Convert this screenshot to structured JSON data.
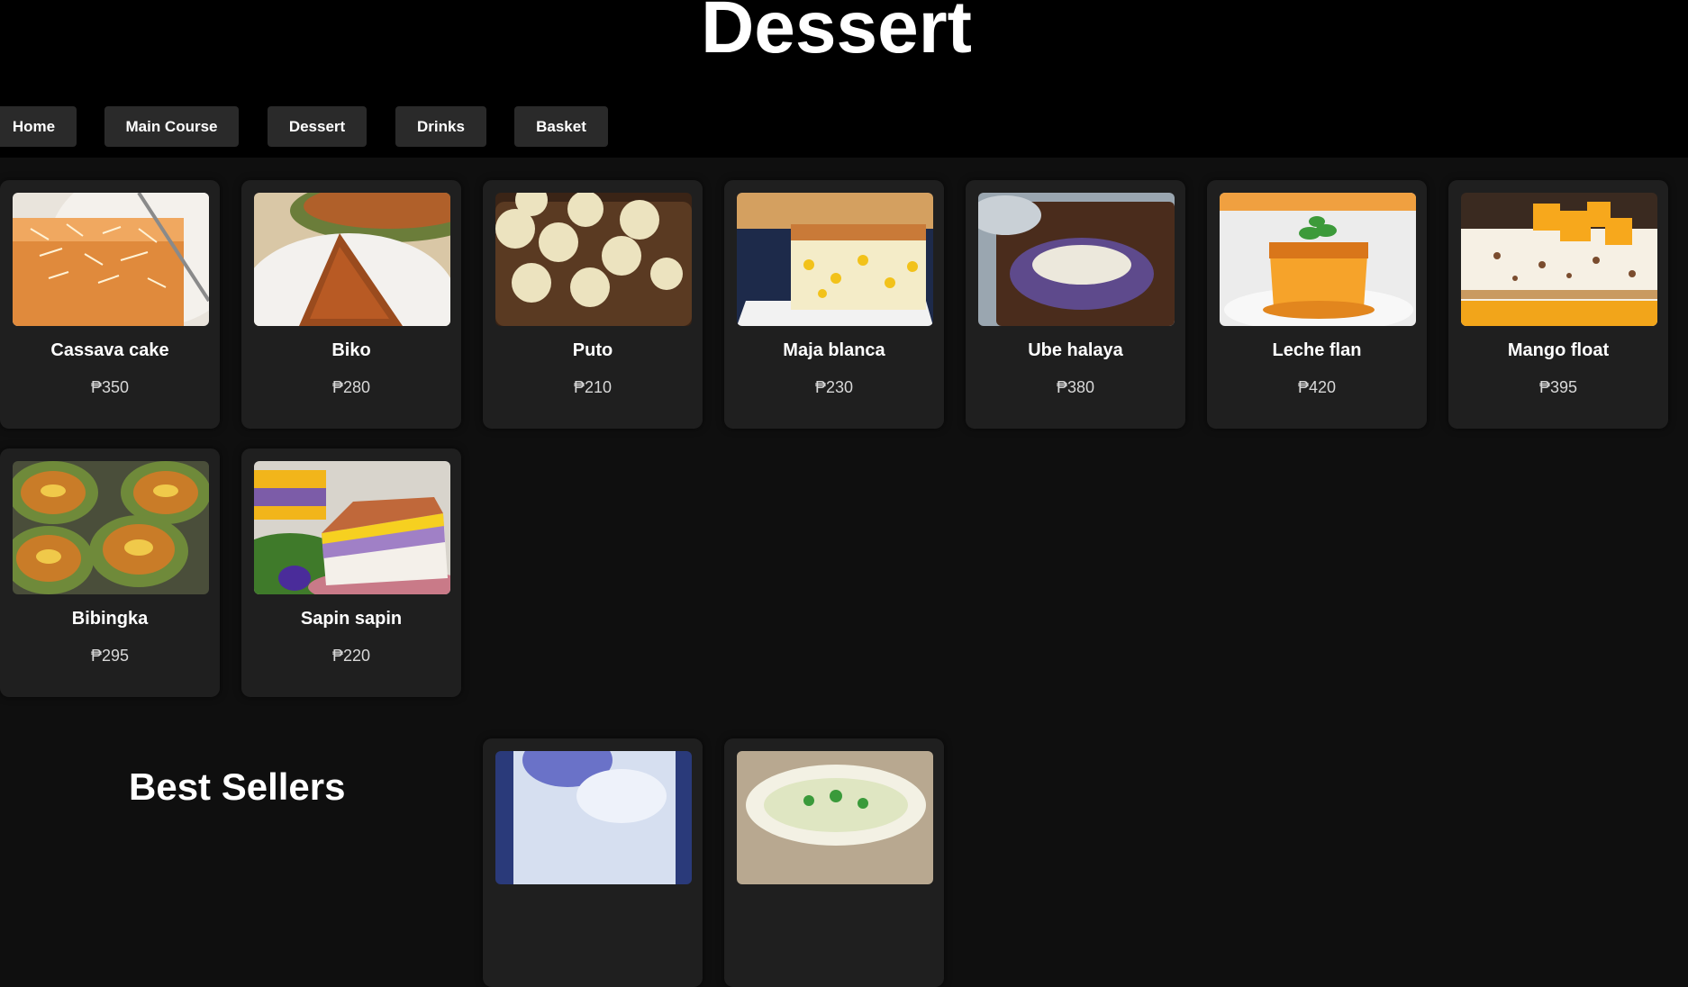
{
  "header": {
    "title": "Dessert"
  },
  "nav": [
    {
      "label": "Home"
    },
    {
      "label": "Main Course"
    },
    {
      "label": "Dessert"
    },
    {
      "label": "Drinks"
    },
    {
      "label": "Basket"
    }
  ],
  "products": [
    {
      "name": "Cassava cake",
      "price": "₱350"
    },
    {
      "name": "Biko",
      "price": "₱280"
    },
    {
      "name": "Puto",
      "price": "₱210"
    },
    {
      "name": "Maja blanca",
      "price": "₱230"
    },
    {
      "name": "Ube halaya",
      "price": "₱380"
    },
    {
      "name": "Leche flan",
      "price": "₱420"
    },
    {
      "name": "Mango float",
      "price": "₱395"
    },
    {
      "name": "Bibingka",
      "price": "₱295"
    },
    {
      "name": "Sapin sapin",
      "price": "₱220"
    }
  ],
  "best_sellers": {
    "title": "Best Sellers"
  }
}
